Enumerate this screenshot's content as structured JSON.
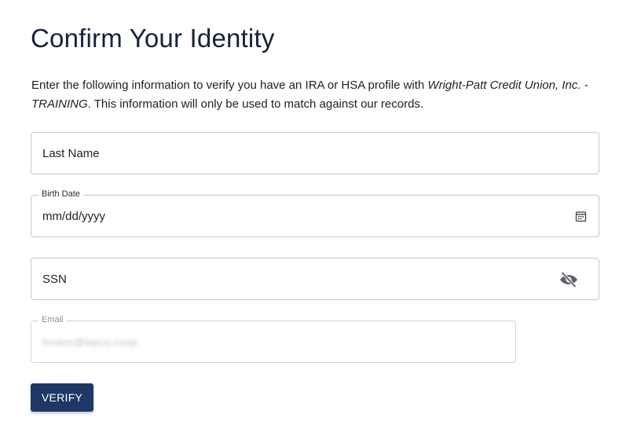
{
  "page": {
    "title": "Confirm Your Identity",
    "intro_before": "Enter the following information to verify you have an IRA or HSA profile with ",
    "intro_org": "Wright-Patt Credit Union, Inc. - TRAINING",
    "intro_after": ". This information will only be used to match against our records."
  },
  "form": {
    "last_name": {
      "placeholder": "Last Name"
    },
    "birth_date": {
      "label": "Birth Date",
      "value": "mm/dd/yyyy",
      "icon": "calendar-icon"
    },
    "ssn": {
      "placeholder": "SSN",
      "icon": "eye-off-icon"
    },
    "email": {
      "label": "Email",
      "value": "lnvans@wpcu.coop",
      "blurred": true
    },
    "verify_label": "VERIFY"
  },
  "colors": {
    "title": "#15223b",
    "button_bg": "#1d3767",
    "border": "#c3c6cc"
  }
}
